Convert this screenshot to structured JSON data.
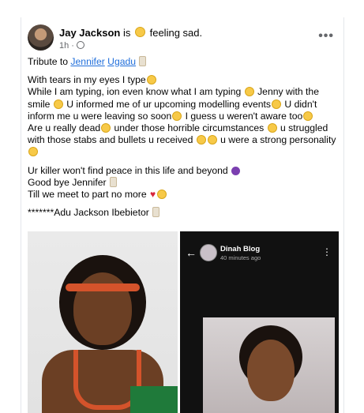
{
  "post": {
    "author": "Jay Jackson",
    "feeling_prefix": "is",
    "feeling": "feeling sad.",
    "time": "1h",
    "more": "•••",
    "lines": {
      "tribute_prefix": "Tribute to ",
      "tribute_link1": "Jennifer",
      "tribute_link2": "Ugadu",
      "p1": "With tears in my eyes I type",
      "p2a": "While I am typing, ion even know what I am typing",
      "p2b": " Jenny with the smile",
      "p2c": " U informed me of ur upcoming modelling events",
      "p2d": " U didn't inform me u were leaving so soon",
      "p2e": " I guess u weren't aware too",
      "p2f": "Are u really dead",
      "p2g": " under those horrible circumstances",
      "p2h": " u struggled with those stabs and bullets u received",
      "p2i": " u were a strong personality",
      "p3a": "Ur killer won't find peace in this life and beyond",
      "p3b": "Good bye Jennifer",
      "p3c": "Till we meet to part no more",
      "p4": "*******Adu Jackson Ibebietor"
    }
  },
  "embedded": {
    "blog_name": "Dinah Blog",
    "blog_time": "40 minutes ago"
  },
  "icons": [
    "crying-emoji",
    "sad-emoji",
    "purple-devil-emoji",
    "broken-heart-emoji",
    "scroll-emoji",
    "globe-icon",
    "back-arrow-icon",
    "kebab-menu-icon"
  ]
}
